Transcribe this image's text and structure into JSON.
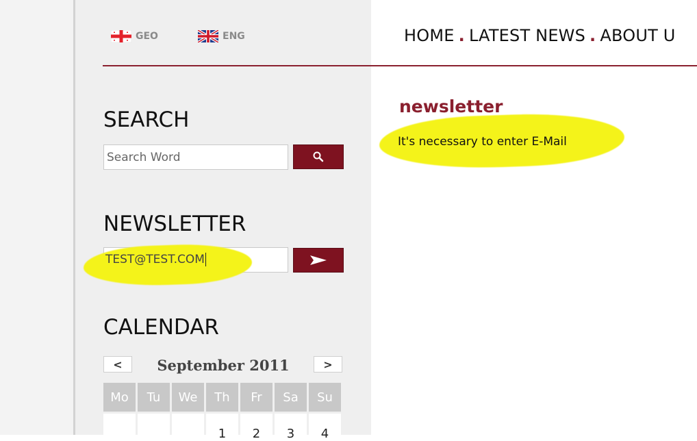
{
  "languages": [
    {
      "code": "GEO",
      "flag": "georgia-flag"
    },
    {
      "code": "ENG",
      "flag": "uk-flag"
    }
  ],
  "nav": {
    "items": [
      "HOME",
      "LATEST NEWS",
      "ABOUT U"
    ],
    "separator": "."
  },
  "search": {
    "title": "SEARCH",
    "placeholder": "Search Word",
    "button_icon": "magnifier-icon"
  },
  "newsletter": {
    "title": "NEWSLETTER",
    "value": "TEST@TEST.COM",
    "button_icon": "arrow-right-icon"
  },
  "calendar": {
    "title": "CALENDAR",
    "month": "September 2011",
    "prev": "<",
    "next": ">",
    "weekdays": [
      "Mo",
      "Tu",
      "We",
      "Th",
      "Fr",
      "Sa",
      "Su"
    ],
    "first_row": [
      "",
      "",
      "",
      "1",
      "2",
      "3",
      "4"
    ]
  },
  "main": {
    "heading": "newsletter",
    "message": "It's necessary to enter E-Mail"
  },
  "colors": {
    "accent": "#8a1f2e",
    "button": "#7e1220",
    "highlight": "#f4f31a",
    "sidebar_bg": "#efefef"
  }
}
